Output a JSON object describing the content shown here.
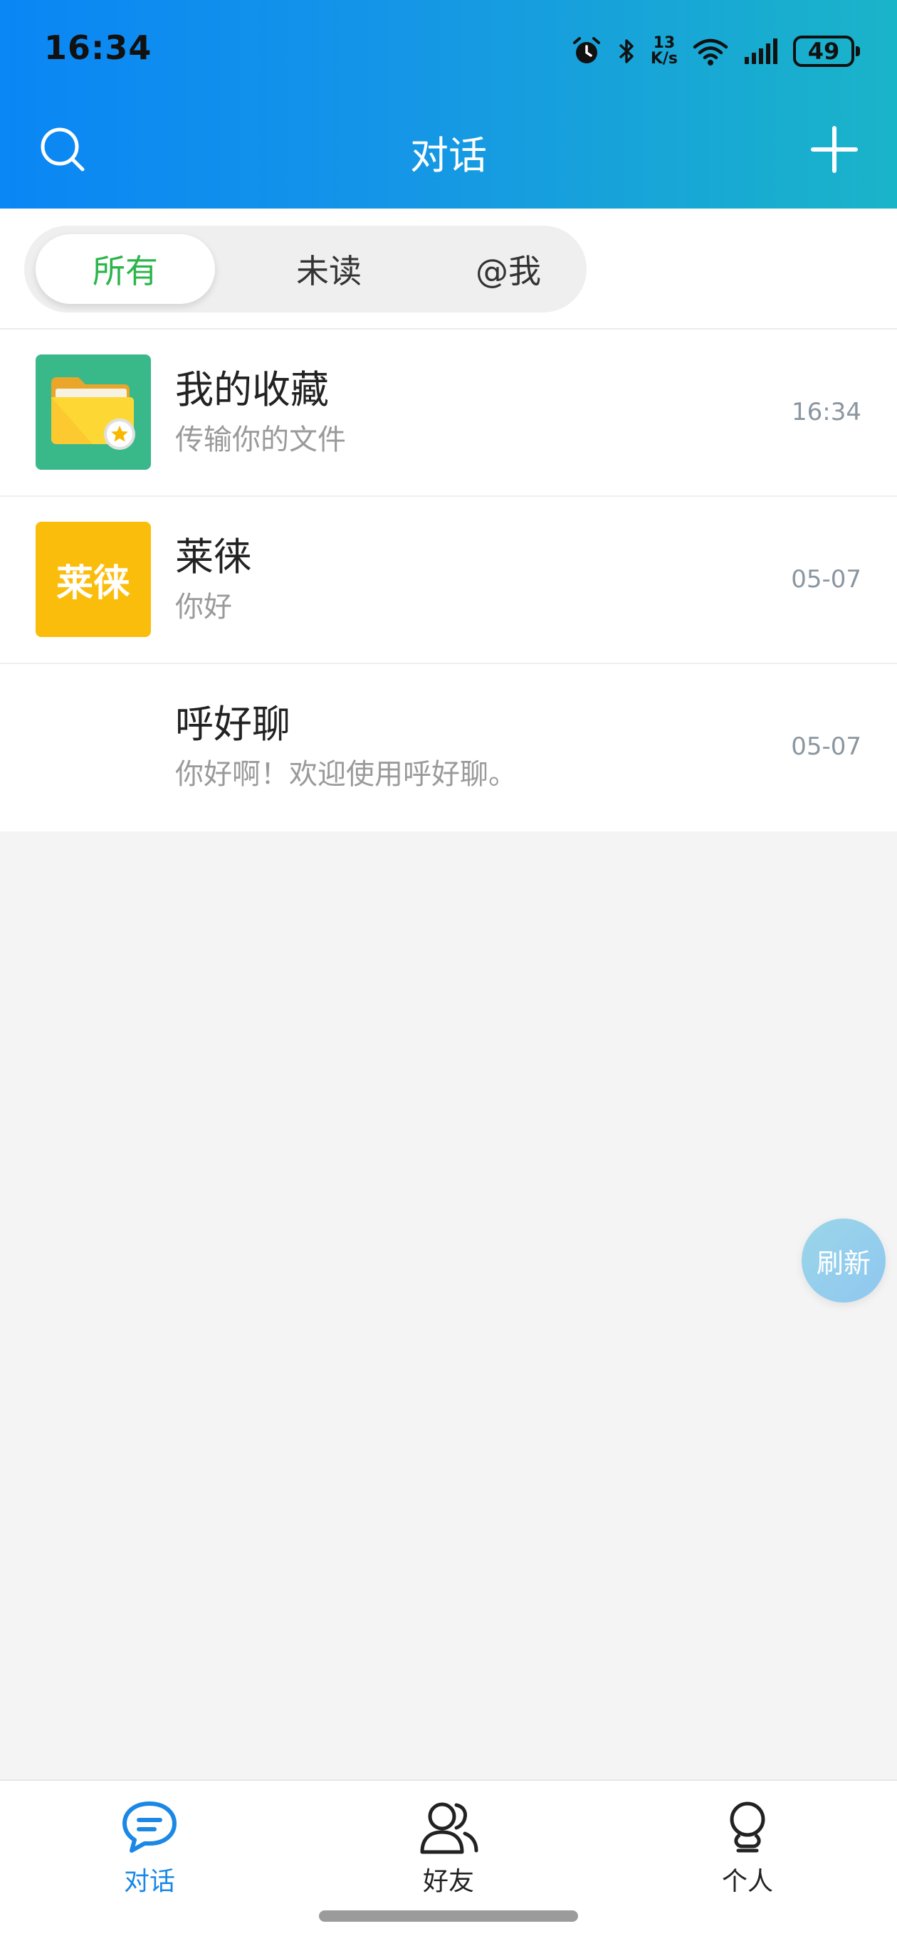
{
  "status_bar": {
    "time": "16:34",
    "net_speed_value": "13",
    "net_speed_unit": "K/s",
    "battery": "49",
    "icons": [
      "alarm-icon",
      "bluetooth-icon",
      "wifi-icon",
      "signal-icon",
      "battery-icon"
    ]
  },
  "header": {
    "title": "对话",
    "left_icon": "search-icon",
    "right_icon": "plus-icon"
  },
  "filters": {
    "active_index": 0,
    "items": [
      {
        "label": "所有"
      },
      {
        "label": "未读"
      },
      {
        "label": "@我"
      }
    ]
  },
  "conversations": [
    {
      "name": "我的收藏",
      "message": "传输你的文件",
      "time": "16:34",
      "avatar_icon": "folder-star-icon",
      "avatar_color": "#39b88a"
    },
    {
      "name": "莱徕",
      "message": "你好",
      "time": "05-07",
      "avatar_text": "莱徕",
      "avatar_color": "#fbbd0c"
    },
    {
      "name": "呼好聊",
      "message": "你好啊！欢迎使用呼好聊。",
      "time": "05-07"
    }
  ],
  "refresh_button": {
    "label": "刷新"
  },
  "tabbar": {
    "active_index": 0,
    "items": [
      {
        "label": "对话",
        "icon": "chat-bubble-icon"
      },
      {
        "label": "好友",
        "icon": "friends-icon"
      },
      {
        "label": "个人",
        "icon": "person-icon"
      }
    ]
  },
  "colors": {
    "accent": "#1b88e6",
    "active_filter": "#2bb54a",
    "header_start": "#0a86f5",
    "header_end": "#1ab4c9"
  }
}
